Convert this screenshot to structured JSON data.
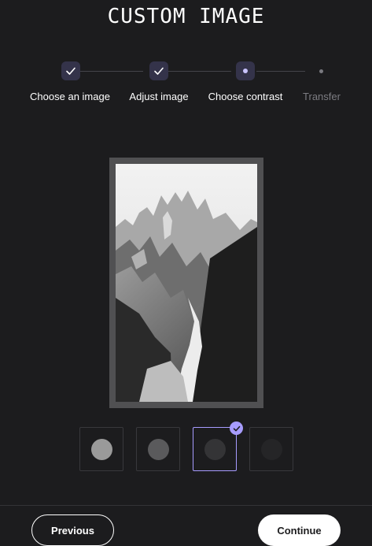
{
  "page": {
    "title": "CUSTOM IMAGE"
  },
  "stepper": {
    "steps": [
      {
        "label": "Choose an image",
        "state": "done"
      },
      {
        "label": "Adjust image",
        "state": "done"
      },
      {
        "label": "Choose contrast",
        "state": "current"
      },
      {
        "label": "Transfer",
        "state": "pending"
      }
    ]
  },
  "contrast_options": [
    {
      "color": "#9a9a9a",
      "selected": false
    },
    {
      "color": "#5a5a5c",
      "selected": false
    },
    {
      "color": "#343436",
      "selected": true
    },
    {
      "color": "#252527",
      "selected": false
    }
  ],
  "footer": {
    "previous_label": "Previous",
    "continue_label": "Continue"
  },
  "colors": {
    "accent": "#a79cff",
    "background": "#1c1c1e"
  },
  "icons": {
    "done": "check-icon",
    "selected_badge": "check-icon"
  }
}
